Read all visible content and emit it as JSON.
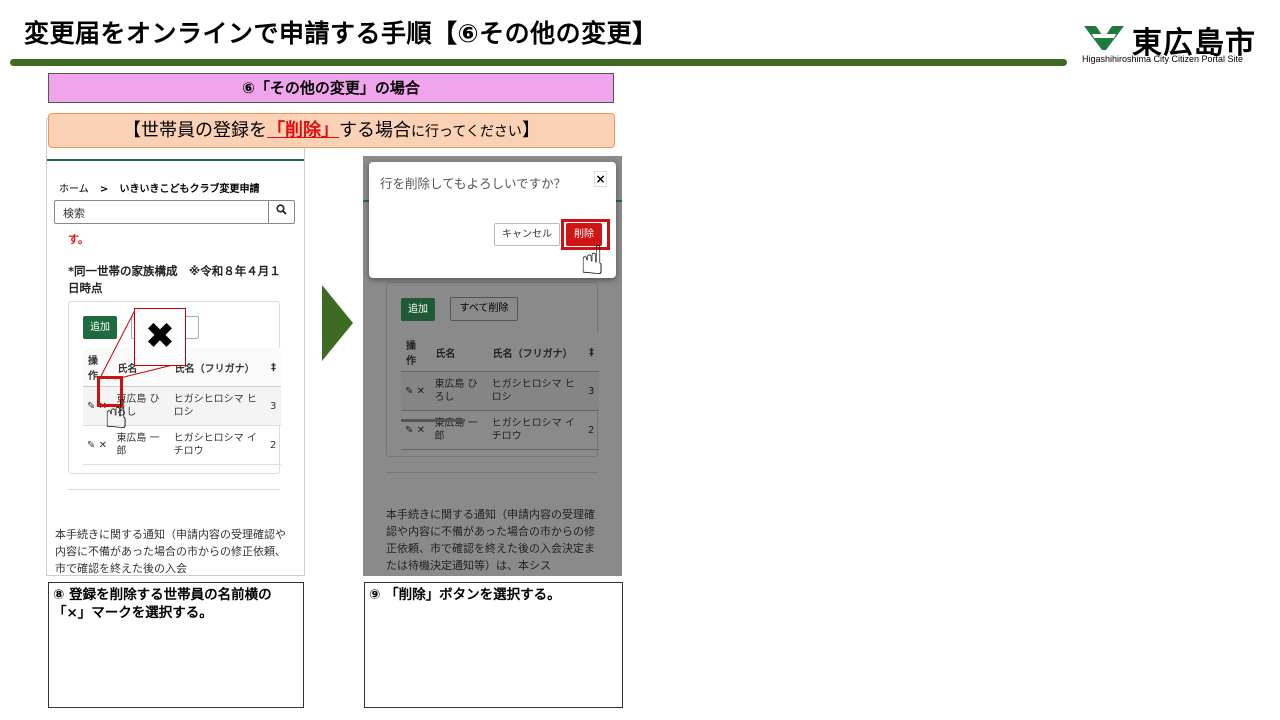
{
  "header": {
    "title": "変更届をオンラインで申請する手順【⑥その他の変更】",
    "logo_text": "東広島市",
    "logo_subtitle": "Higashihiroshima City Citizen Portal Site"
  },
  "section_label": "⑥「その他の変更」の場合",
  "banner": {
    "prefix": "【世帯員の登録を",
    "highlight": "「削除」",
    "middle": "する場合",
    "small": "に行ってください",
    "suffix": "】"
  },
  "screen1": {
    "breadcrumb_home": "ホーム",
    "breadcrumb_sep": ">",
    "breadcrumb_page": "いきいきこどもクラブ変更申請",
    "search_placeholder": "検索",
    "search_icon": "magnifier-icon",
    "red_fragment": "す。",
    "family_label": "*同一世帯の家族構成　※令和８年４月１日時点",
    "add_button": "追加",
    "zoom_symbol": "✖",
    "table_headers": [
      "操作",
      "氏名",
      "氏名（フリガナ）",
      "‡"
    ],
    "rows": [
      {
        "name": "東広島 ひろし",
        "kana": "ヒガシヒロシマ ヒロシ",
        "extra": "3"
      },
      {
        "name": "東広島 一郎",
        "kana": "ヒガシヒロシマ イチロウ",
        "extra": "2"
      }
    ],
    "notice": "本手続きに関する通知（申請内容の受理確認や内容に不備があった場合の市からの修正依頼、市で確認を終えた後の入会"
  },
  "screen2": {
    "dialog_message": "行を削除してもよろしいですか？",
    "dialog_close": "×",
    "cancel_button": "キャンセル",
    "delete_button": "削除",
    "add_button": "追加",
    "delete_all_button": "すべて削除",
    "table_headers": [
      "操作",
      "氏名",
      "氏名（フリガナ）",
      "‡"
    ],
    "rows": [
      {
        "name": "東広島 ひろし",
        "kana": "ヒガシヒロシマ ヒロシ",
        "extra": "3"
      },
      {
        "name": "東広島 一郎",
        "kana": "ヒガシヒロシマ イチロウ",
        "extra": "2"
      }
    ],
    "notice": "本手続きに関する通知（申請内容の受理確認や内容に不備があった場合の市からの修正依頼、市で確認を終えた後の入会決定または待機決定通知等）は、本シス"
  },
  "captions": {
    "step8": "⑧ 登録を削除する世帯員の名前横の「×」マークを選択する。",
    "step9": "⑨ 「削除」ボタンを選択する。"
  },
  "colors": {
    "brand_green": "#3d6b24",
    "section_pink": "#f0a5ea",
    "banner_peach": "#fad1b5",
    "highlight_red": "#d01010"
  }
}
